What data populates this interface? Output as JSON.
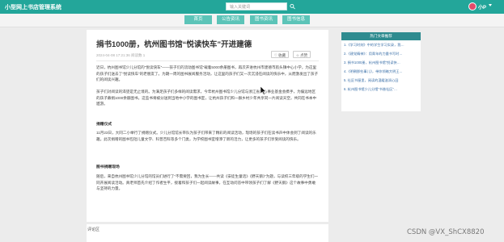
{
  "header": {
    "brand": "小型网上书店管理系统",
    "search_placeholder": "输入关键词",
    "username": "小P",
    "accent": "#23a69a"
  },
  "nav": {
    "tabs": [
      "首页",
      "公告资讯",
      "图书资讯",
      "图书信息"
    ]
  },
  "article": {
    "title": "捐书1000册，杭州图书馆“悦读快车”开进建德",
    "meta": "2024-04-08 17:21:36            阅读数 1",
    "like_label": "♡ 收藏",
    "share_label": "☆ 点赞",
    "paragraphs": [
      "近日，杭州图书馆少儿分馆的“悦读快车”——孩子们的流动图书馆”载着5000余册图书，再次开进杭州市建德市航头镇中心小学，为这里的孩子们送去了“悦读快车”的老朋友了。为期一周的图书展阅服务活动，让这里的孩子们又一次沉浸在阅读的快乐中，从而激发出了孩子们的阅读兴趣。",
      "孩子们对阅读的渴望是无止境的。为满足孩子们多样的阅读需求，今年杭州图书馆少儿分馆与浙江省爱心事业基金会携手，为偏远地区的孩子募捐1000余册图书。这些书将被分送到当地中小学的图书室，让杭州孩子们和一群乡村少年共享同一片阅读天空，共同在书本中遨游。",
      "11月23日，大同二小举行了捐赠仪式。少儿分馆馆长带队为孩子们带来了精彩的阅读活动，现场的孩子们在读书声中体会到了阅读的乐趣。此次捐赠的图书包括儿童文学、科普百科等多个门类，为学校图书室增添了新的活力，让更多的孩子们享受阅读的快乐。",
      "随后，来自杭州图书馆少儿分馆的馆员们进行了“不需要回，我为生长——共读《安徒生童话》《野天鹅》”为题，与读校三年级的学生们一同开展阅读活动。真老师首先介绍了作者生平，接着和孩子们一起阅读故事，在互动问答中带领孩子们了解《野天鹅》这个故事中勇敢与坚持的力量。"
    ],
    "heading_1": "捐赠仪式",
    "heading_2": "图书捐赠现场"
  },
  "comments": {
    "label": "评论区"
  },
  "sidebar": {
    "title": "热门文章推荐",
    "items": [
      "1.《学习时刻》中的学生学习实录，我…",
      "2.《建党精神》：用青年的力量书写时…",
      "3. 捐书1000册，杭州图书馆“悦读快…",
      "4.《明朝那些事儿》，带你领略大明王…",
      "5. 社区书屋里，阅读的温暖滋润心田",
      "6. 杭州图书馆少儿分馆“书香社区”…"
    ]
  },
  "watermark": "CSDN @VX_ShCX8820"
}
